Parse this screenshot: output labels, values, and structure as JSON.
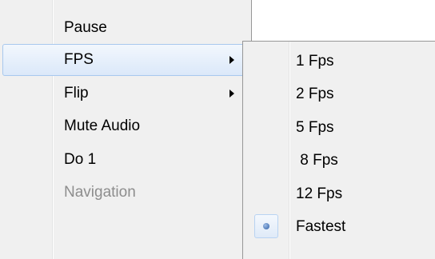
{
  "main_menu": {
    "items": [
      {
        "label": "Pause",
        "state": "normal"
      },
      {
        "label": "FPS",
        "state": "highlighted",
        "submenu": true
      },
      {
        "label": "Flip",
        "state": "normal",
        "submenu": true
      },
      {
        "label": "Mute Audio",
        "state": "normal"
      },
      {
        "label": "Do 1",
        "state": "normal"
      },
      {
        "label": "Navigation",
        "state": "disabled"
      }
    ]
  },
  "fps_submenu": {
    "items": [
      {
        "label": "1 Fps"
      },
      {
        "label": "2 Fps"
      },
      {
        "label": "5 Fps"
      },
      {
        "label": " 8 Fps"
      },
      {
        "label": "12 Fps"
      },
      {
        "label": "Fastest",
        "selected": true
      }
    ]
  },
  "colors": {
    "menu_bg": "#f0f0f0",
    "highlight_border": "#a8c8ee",
    "disabled_text": "#8d8d8d",
    "radio_dot": "#2f5fa6"
  }
}
